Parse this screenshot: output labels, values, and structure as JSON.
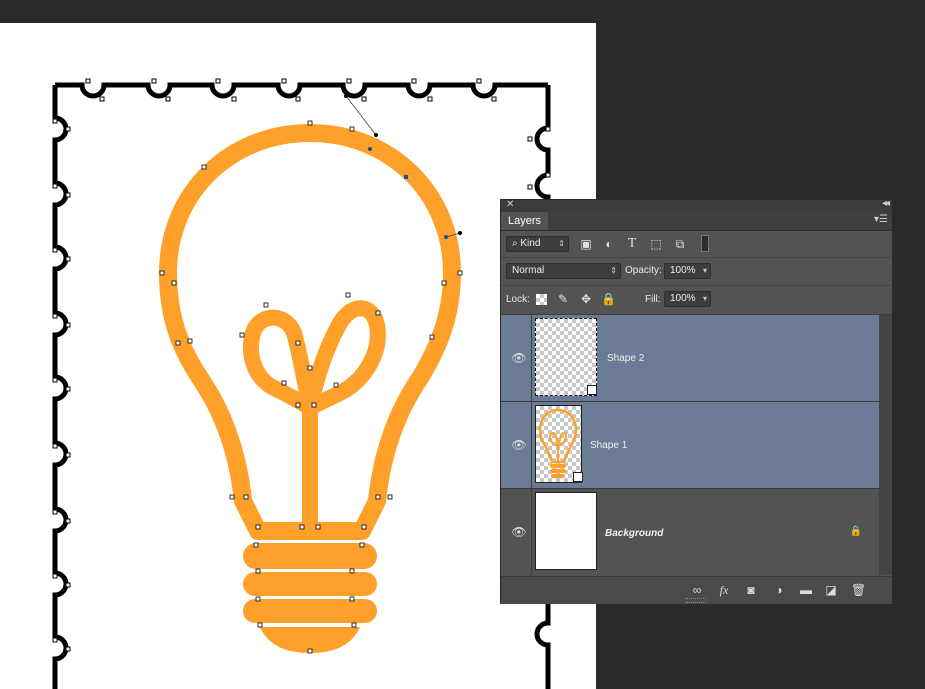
{
  "canvas": {
    "background": "#ffffff",
    "bulb_color": "#ffa02a",
    "frame_color": "#000000"
  },
  "layers_panel": {
    "tab": "Layers",
    "filter": {
      "label": "Kind"
    },
    "blend_mode": "Normal",
    "opacity_label": "Opacity:",
    "opacity_value": "100%",
    "lock_label": "Lock:",
    "fill_label": "Fill:",
    "fill_value": "100%",
    "layers": [
      {
        "name": "Shape 2",
        "visible": true,
        "selected": true
      },
      {
        "name": "Shape 1",
        "visible": true,
        "selected": true
      },
      {
        "name": "Background",
        "visible": true,
        "selected": false,
        "locked": true
      }
    ],
    "footer_icons": [
      "link-icon",
      "fx-icon",
      "mask-icon",
      "adjustment-icon",
      "folder-icon",
      "new-layer-icon",
      "trash-icon"
    ]
  }
}
